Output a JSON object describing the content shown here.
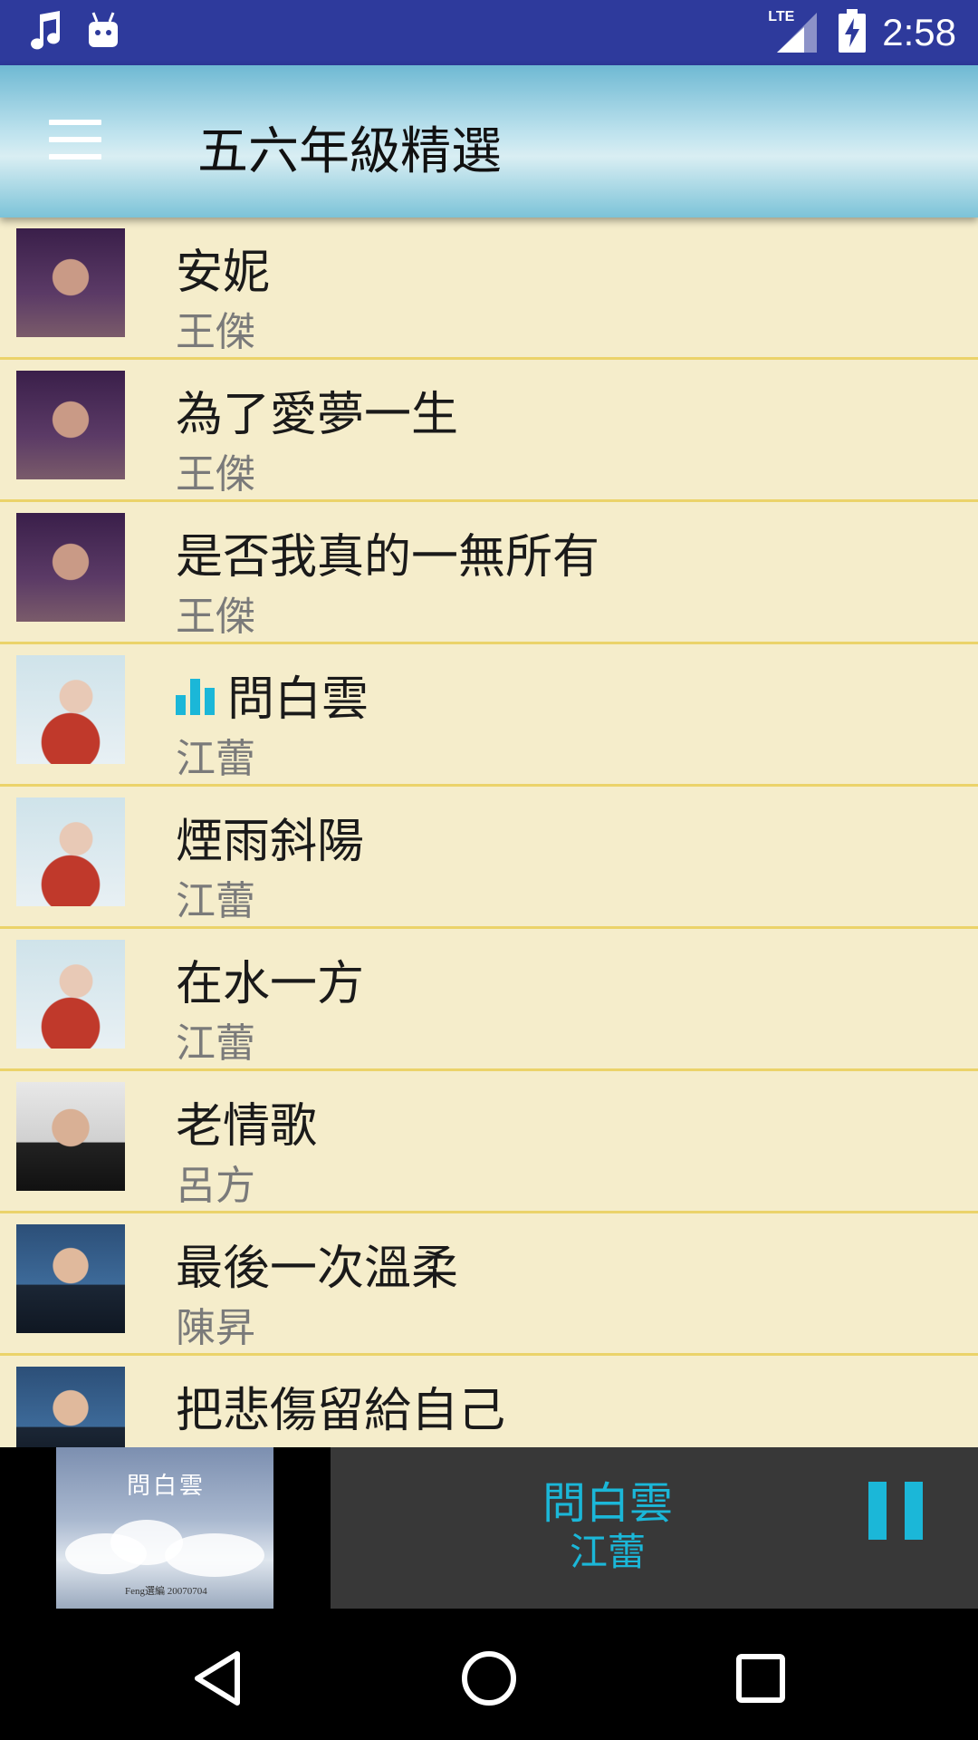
{
  "status_bar": {
    "time": "2:58",
    "network": "LTE",
    "icons": [
      "music-note-icon",
      "android-icon",
      "lte-signal-icon",
      "battery-charging-icon"
    ]
  },
  "app_bar": {
    "title": "五六年級精選",
    "menu_icon": "hamburger-menu-icon"
  },
  "songs": [
    {
      "title": "安妮",
      "artist": "王傑",
      "playing": false
    },
    {
      "title": "為了愛夢一生",
      "artist": "王傑",
      "playing": false
    },
    {
      "title": "是否我真的一無所有",
      "artist": "王傑",
      "playing": false
    },
    {
      "title": "問白雲",
      "artist": "江蕾",
      "playing": true
    },
    {
      "title": "煙雨斜陽",
      "artist": "江蕾",
      "playing": false
    },
    {
      "title": "在水一方",
      "artist": "江蕾",
      "playing": false
    },
    {
      "title": "老情歌",
      "artist": "呂方",
      "playing": false
    },
    {
      "title": "最後一次溫柔",
      "artist": "陳昇",
      "playing": false
    },
    {
      "title": "把悲傷留給自己",
      "artist": "",
      "playing": false
    }
  ],
  "now_playing": {
    "title": "問白雲",
    "artist": "江蕾",
    "art_title": "問白雲",
    "art_caption": "Feng選編 20070704",
    "control_icon": "pause-icon"
  },
  "nav": {
    "icons": [
      "back-icon",
      "home-icon",
      "recents-icon"
    ]
  },
  "colors": {
    "status_bar": "#2E3A9C",
    "list_bg": "#F5EDCB",
    "divider": "#EBD36A",
    "accent": "#1BB7D8",
    "player_bg": "#383838"
  }
}
